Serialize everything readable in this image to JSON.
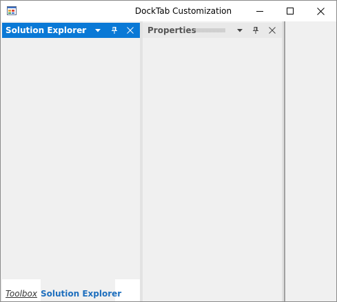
{
  "window": {
    "title": "DockTab Customization",
    "icon": "app-form-icon",
    "controls": [
      "minimize-icon",
      "maximize-icon",
      "close-icon"
    ]
  },
  "panels": {
    "solution_explorer": {
      "title": "Solution Explorer",
      "active": true,
      "header_color": "#0a79d6",
      "icons": [
        "dropdown-arrow-icon",
        "pin-icon",
        "close-icon"
      ]
    },
    "properties": {
      "title": "Properties",
      "active": false,
      "icons": [
        "dropdown-arrow-icon",
        "pin-icon",
        "close-icon"
      ]
    }
  },
  "tabs": [
    {
      "label": "Toolbox",
      "selected": false
    },
    {
      "label": "Solution Explorer",
      "selected": true,
      "color": "#1e6fbe"
    }
  ]
}
